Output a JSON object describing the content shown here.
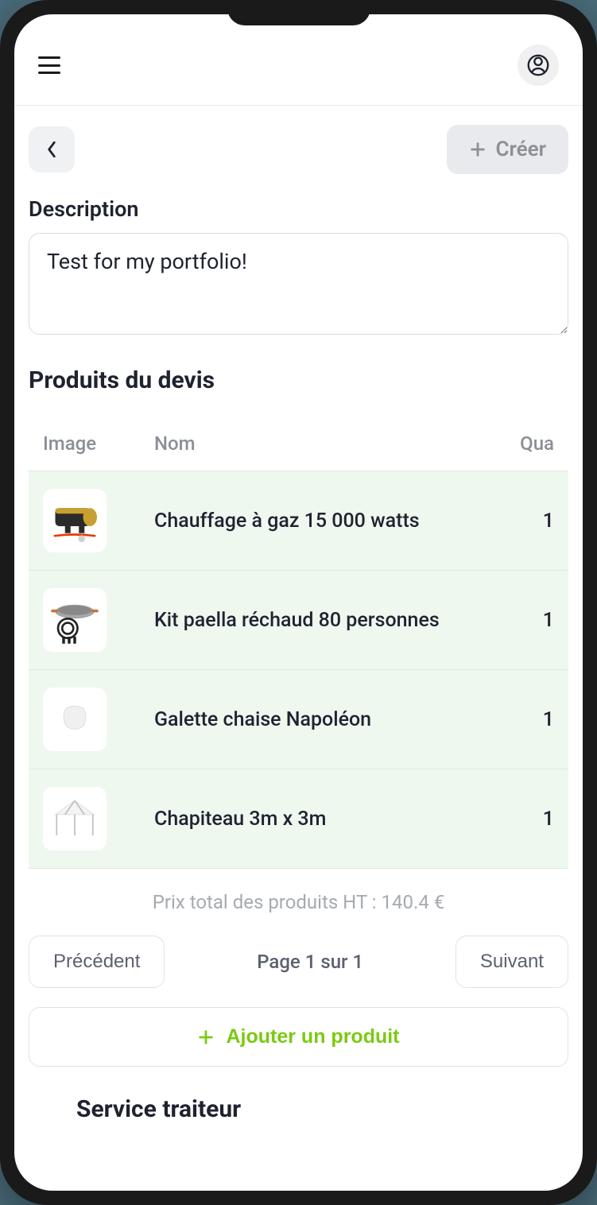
{
  "toolbar": {
    "create_label": "Créer"
  },
  "description": {
    "label": "Description",
    "value": "Test for my portfolio!"
  },
  "products": {
    "heading": "Produits du devis",
    "columns": {
      "image": "Image",
      "name": "Nom",
      "quantity": "Qua"
    },
    "rows": [
      {
        "name": "Chauffage à gaz 15 000 watts",
        "quantity": "1",
        "icon": "heater"
      },
      {
        "name": "Kit paella réchaud 80 personnes",
        "quantity": "1",
        "icon": "paella"
      },
      {
        "name": "Galette chaise Napoléon",
        "quantity": "1",
        "icon": "cushion"
      },
      {
        "name": "Chapiteau 3m x 3m",
        "quantity": "1",
        "icon": "tent"
      }
    ],
    "total_label": "Prix total des produits HT : 140.4 €"
  },
  "pagination": {
    "previous": "Précédent",
    "indicator": "Page 1 sur 1",
    "next": "Suivant"
  },
  "add_product_label": "Ajouter un produit",
  "next_section_heading": "Service traiteur"
}
